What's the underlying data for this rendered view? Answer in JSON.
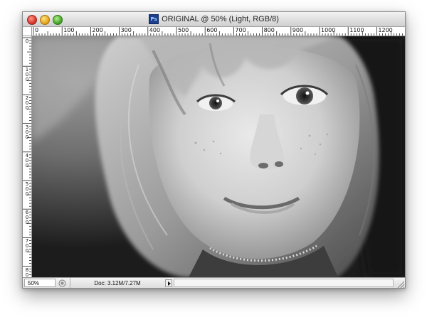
{
  "window": {
    "app_icon": "ps-icon",
    "app_icon_label": "Ps",
    "title": "ORIGINAL @ 50% (Light, RGB/8)"
  },
  "rulers": {
    "horizontal_labels": [
      "0",
      "100",
      "200",
      "300",
      "400",
      "500",
      "600",
      "700",
      "800",
      "900",
      "1000",
      "1100",
      "1200"
    ],
    "vertical_labels": [
      "0",
      "100",
      "200",
      "300",
      "400",
      "500",
      "600",
      "700",
      "800"
    ]
  },
  "status_bar": {
    "zoom": "50%",
    "doc_info": "Doc: 3.12M/7.27M",
    "status_icon": "info-icon",
    "menu_arrow_icon": "triangle-right-icon"
  },
  "colors": {
    "titlebar_top": "#f2f2f2",
    "titlebar_bottom": "#cfcfcf",
    "close_button": "#d8352a",
    "minimize_button": "#e6a81c",
    "zoom_button": "#45a829",
    "ps_icon_bg": "#1c3f8f"
  },
  "canvas": {
    "image_subject": "black and white portrait photograph"
  }
}
